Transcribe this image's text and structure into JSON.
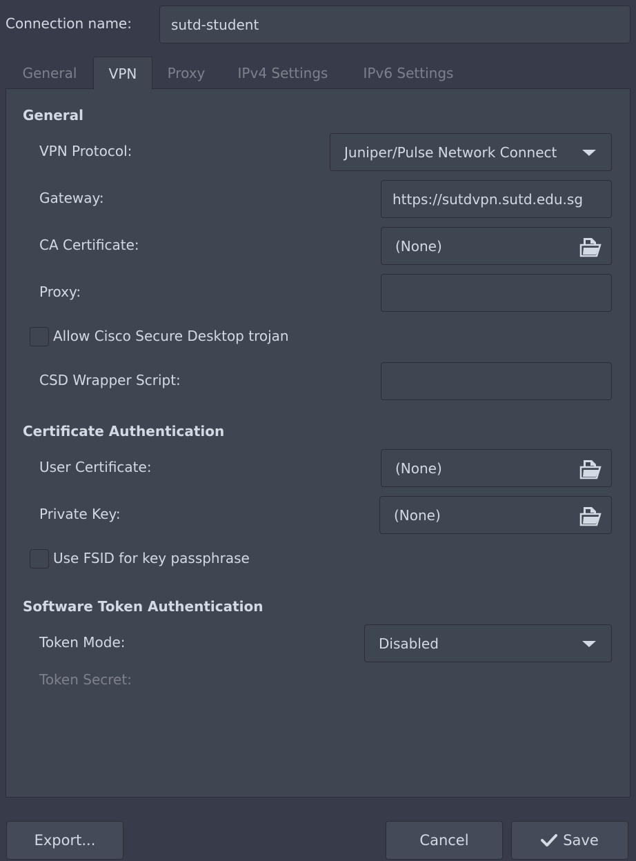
{
  "connection": {
    "name_label": "Connection name:",
    "name_value": "sutd-student"
  },
  "tabs": [
    {
      "label": "General",
      "active": false
    },
    {
      "label": "VPN",
      "active": true
    },
    {
      "label": "Proxy",
      "active": false
    },
    {
      "label": "IPv4 Settings",
      "active": false
    },
    {
      "label": "IPv6 Settings",
      "active": false
    }
  ],
  "general": {
    "heading": "General",
    "vpn_protocol_label": "VPN Protocol:",
    "vpn_protocol_value": "Juniper/Pulse Network Connect",
    "gateway_label": "Gateway:",
    "gateway_value": "https://sutdvpn.sutd.edu.sg",
    "ca_cert_label": "CA Certificate:",
    "ca_cert_value": "(None)",
    "proxy_label": "Proxy:",
    "proxy_value": "",
    "csd_trojan_label": "Allow Cisco Secure Desktop trojan",
    "csd_trojan_checked": false,
    "csd_wrapper_label": "CSD Wrapper Script:",
    "csd_wrapper_value": ""
  },
  "cert_auth": {
    "heading": "Certificate Authentication",
    "user_cert_label": "User Certificate:",
    "user_cert_value": "(None)",
    "private_key_label": "Private Key:",
    "private_key_value": "(None)",
    "fsid_label": "Use FSID for key passphrase",
    "fsid_checked": false
  },
  "token_auth": {
    "heading": "Software Token Authentication",
    "token_mode_label": "Token Mode:",
    "token_mode_value": "Disabled",
    "token_secret_label": "Token Secret:"
  },
  "buttons": {
    "export": "Export...",
    "cancel": "Cancel",
    "save": "Save"
  },
  "colors": {
    "window_bg": "#383c4a",
    "panel_bg": "#404552",
    "border": "#2b2e39",
    "text": "#d3dae3",
    "dim_text": "#7c818c"
  }
}
